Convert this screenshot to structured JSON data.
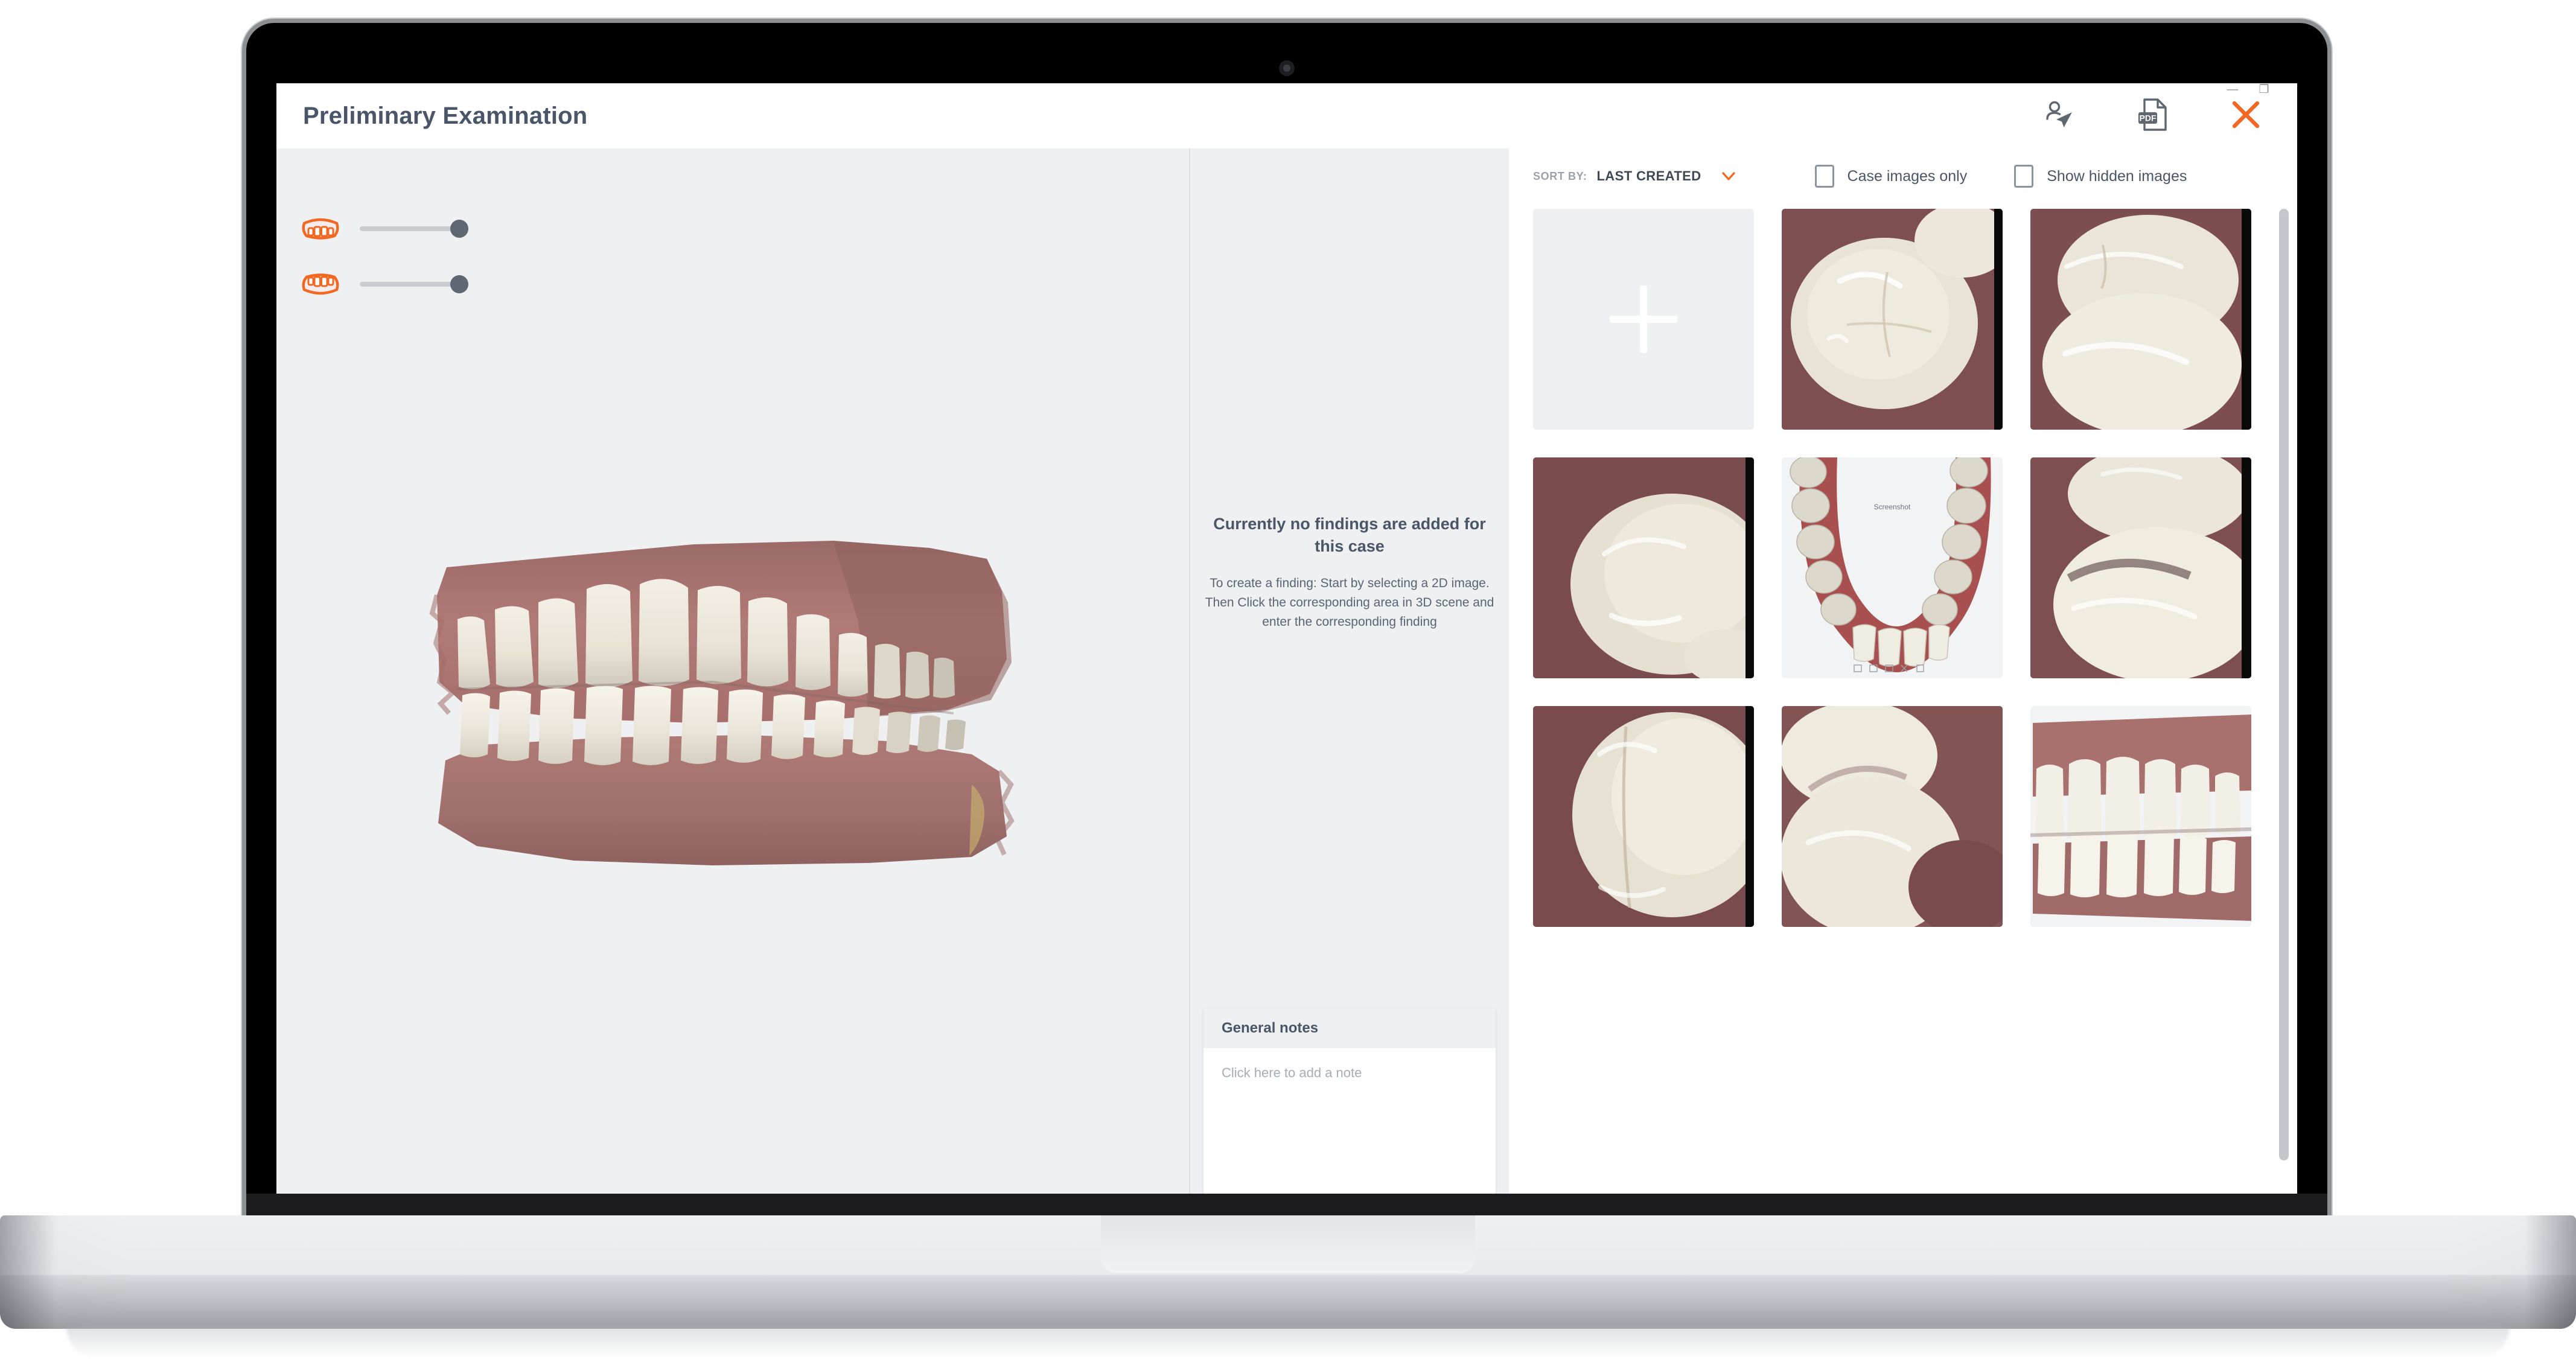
{
  "window": {
    "title": "Preliminary Examination",
    "minimize_label": "—",
    "restore_label": "❐"
  },
  "header": {
    "actions": [
      {
        "name": "share-with-patient",
        "icon": "person-send-icon"
      },
      {
        "name": "export-pdf",
        "icon": "pdf-file-icon"
      },
      {
        "name": "close-dialog",
        "icon": "close-x-icon"
      }
    ],
    "close_color": "#f26722"
  },
  "viewport": {
    "opacity_controls": [
      {
        "label": "Upper jaw opacity",
        "icon": "upper-arch-icon",
        "value": 100
      },
      {
        "label": "Lower jaw opacity",
        "icon": "lower-arch-icon",
        "value": 100
      }
    ],
    "model_caption": "3D intraoral scan – upper and lower arches in occlusion",
    "accent_color": "#f26722"
  },
  "findings": {
    "empty_title": "Currently no findings are added for this case",
    "empty_description": "To create a finding: Start by selecting a 2D image. Then Click the corresponding area in 3D scene and enter the corresponding finding",
    "notes": {
      "header": "General notes",
      "placeholder": "Click here to add a note",
      "value": ""
    }
  },
  "images": {
    "sort": {
      "label": "SORT BY:",
      "value": "LAST CREATED",
      "chevron": "chevron-down-icon"
    },
    "filters": [
      {
        "label": "Case images only",
        "checked": false
      },
      {
        "label": "Show hidden images",
        "checked": false
      }
    ],
    "add_tile": {
      "label": "Add image",
      "icon": "plus-icon"
    },
    "thumbnails": [
      {
        "name": "occlusal-molar-closeup-1",
        "kind": "intraoral-photo"
      },
      {
        "name": "occlusal-molar-closeup-2",
        "kind": "intraoral-photo"
      },
      {
        "name": "buccal-premolar-closeup",
        "kind": "intraoral-photo"
      },
      {
        "name": "lower-arch-screenshot",
        "kind": "3d-screenshot",
        "caption": "Screenshot"
      },
      {
        "name": "occlusal-contact-closeup",
        "kind": "intraoral-photo"
      },
      {
        "name": "molar-cusp-closeup-1",
        "kind": "intraoral-photo"
      },
      {
        "name": "molar-cusp-closeup-2",
        "kind": "intraoral-photo"
      },
      {
        "name": "anterior-bite-3d-view",
        "kind": "3d-screenshot"
      },
      {
        "name": "anterior-bite-3d-view-2",
        "kind": "3d-screenshot"
      }
    ]
  }
}
